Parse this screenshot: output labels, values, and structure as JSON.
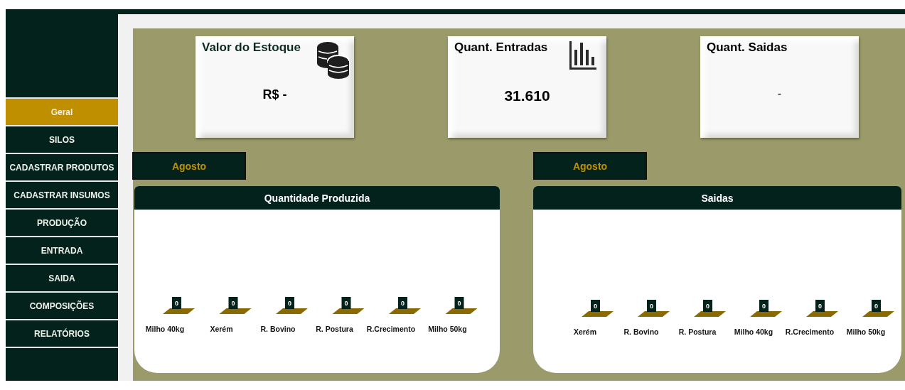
{
  "sidebar": {
    "items": [
      {
        "label": "Geral",
        "selected": true
      },
      {
        "label": "SILOS",
        "selected": false
      },
      {
        "label": "CADASTRAR PRODUTOS",
        "selected": false
      },
      {
        "label": "CADASTRAR INSUMOS",
        "selected": false
      },
      {
        "label": "PRODUÇÃO",
        "selected": false
      },
      {
        "label": "ENTRADA",
        "selected": false
      },
      {
        "label": "SAIDA",
        "selected": false
      },
      {
        "label": "COMPOSIÇÕES",
        "selected": false
      },
      {
        "label": "RELATÓRIOS",
        "selected": false
      }
    ]
  },
  "cards": [
    {
      "title": "Valor do Estoque",
      "value": "R$ -"
    },
    {
      "title": "Quant. Entradas",
      "value": "31.610"
    },
    {
      "title": "Quant. Saidas",
      "value": "-"
    }
  ],
  "panels": [
    {
      "month": "Agosto",
      "title": "Quantidade Produzida",
      "items": [
        {
          "label": "Milho 40kg",
          "value": "0"
        },
        {
          "label": "Xerém",
          "value": "0"
        },
        {
          "label": "R. Bovino",
          "value": "0"
        },
        {
          "label": "R. Postura",
          "value": "0"
        },
        {
          "label": "R.Crecimento",
          "value": "0"
        },
        {
          "label": "Milho 50kg",
          "value": "0"
        }
      ]
    },
    {
      "month": "Agosto",
      "title": "Saidas",
      "items": [
        {
          "label": "Xerém",
          "value": "0"
        },
        {
          "label": "R. Bovino",
          "value": "0"
        },
        {
          "label": "R. Postura",
          "value": "0"
        },
        {
          "label": "Milho 40kg",
          "value": "0"
        },
        {
          "label": "R.Crecimento",
          "value": "0"
        },
        {
          "label": "Milho 50kg",
          "value": "0"
        }
      ]
    }
  ]
}
